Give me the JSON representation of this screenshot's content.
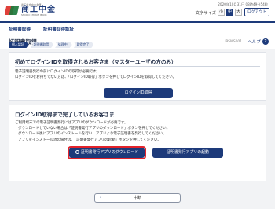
{
  "header": {
    "logo_sub": "商工組合中央金庫",
    "logo_name": "商工中金",
    "logo_eng": "SHOKO CHUKIN BANK",
    "datetime": "2020年10月31日 08時49分54秒",
    "font_size_label": "文字サイズ",
    "font_sizes": [
      "小",
      "中",
      "大"
    ],
    "logout_label": "ログアウト"
  },
  "nav": {
    "items": [
      "証明書取得",
      "証明書取得認証"
    ]
  },
  "page": {
    "title": "証明書取得",
    "screen_id": "BSMS001",
    "help_label": "ヘルプ",
    "help_icon": "?"
  },
  "steps": [
    "個人認証",
    "証明書取得",
    "処理中",
    "取得完了"
  ],
  "section1": {
    "title": "初めてログインIDを取得されるお客さま（マスターユーザの方のみ）",
    "lines": [
      "電子証明書発行の前にログインIDの取得が必要です。",
      "ログインIDをお持ちでない方は、「ログインID取得」ボタンを押してログインIDを取得してください。"
    ],
    "button": "ログインID取得"
  },
  "section2": {
    "title": "ログインID取得まで完了しているお客さま",
    "lines": [
      "ご利用端末での電子証明書発行にはアプリのダウンロードが必要です。",
      "ダウンロードしていない場合は「証明書発行アプリのダウンロード」ボタンを押してください。",
      "ダウンロード後にアプリのインストールを行い、アプリより電子証明書を発行してください。",
      "アプリをインストール済の場合は、「証明書発行アプリの起動」ボタンを押してください。"
    ],
    "download_button": "証明書発行アプリのダウンロード",
    "launch_button": "証明書発行アプリの起動"
  },
  "footer": {
    "back_label": "中断",
    "back_chevron": "‹"
  },
  "colors": {
    "brand_navy": "#1d3a7a",
    "highlight_red": "#e3232b",
    "logo_red": "#e0403a",
    "logo_green": "#1c7a3c"
  }
}
